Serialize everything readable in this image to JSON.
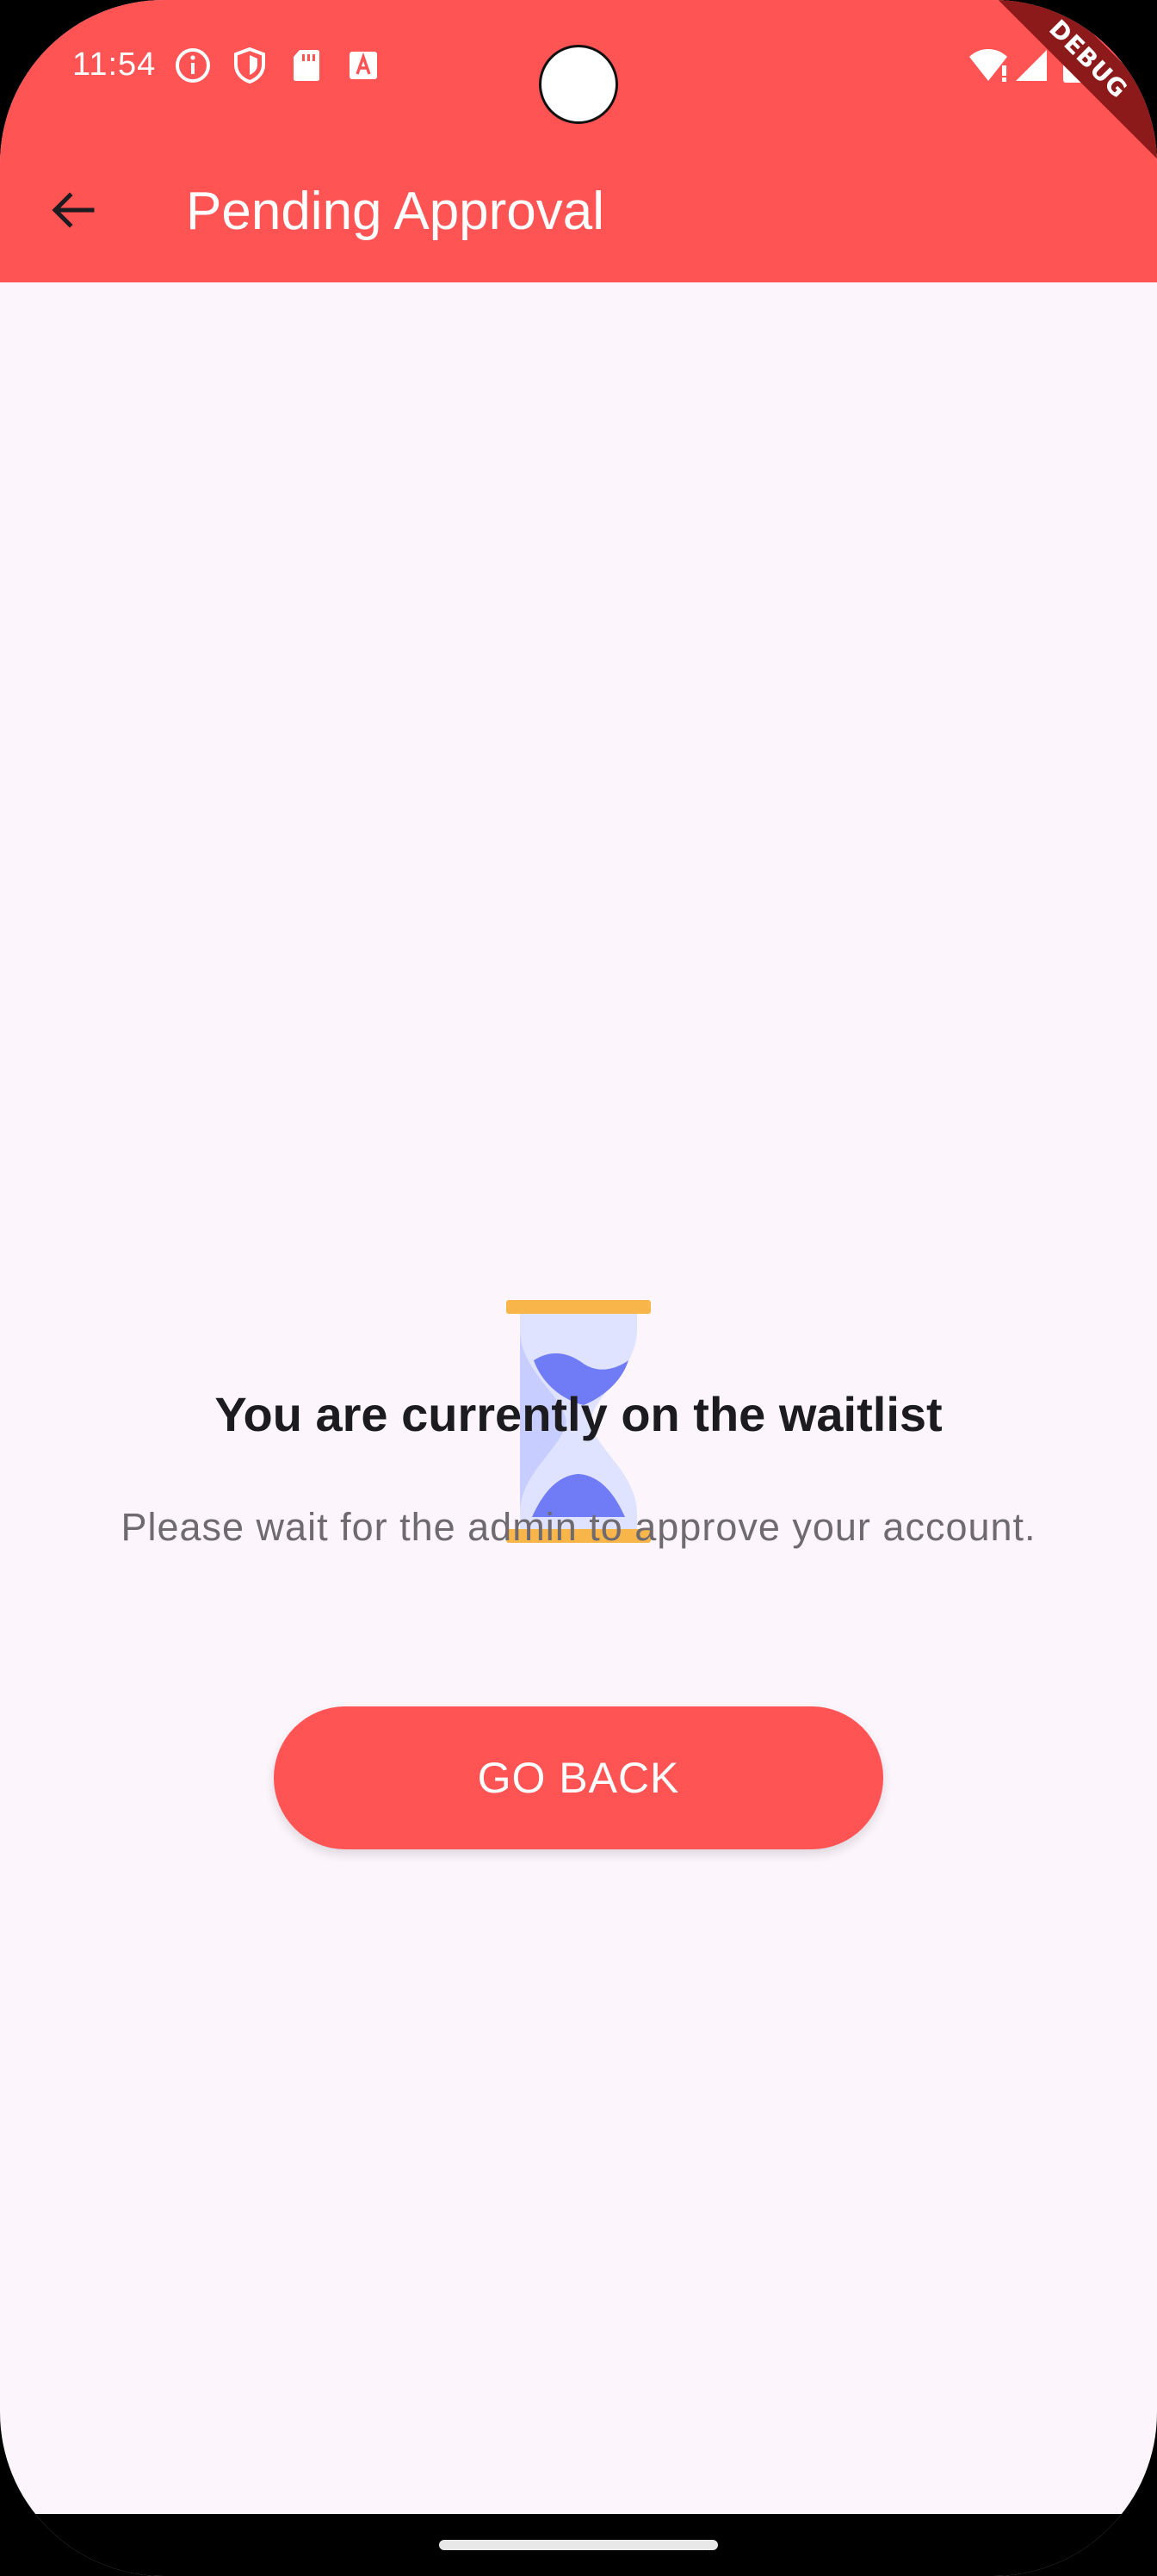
{
  "status_bar": {
    "time": "11:54",
    "left_icons": [
      "info-icon",
      "shield-icon",
      "sd-card-icon",
      "font-a-icon"
    ],
    "right_icons": [
      "wifi-alert-icon",
      "signal-icon",
      "battery-icon"
    ],
    "debug_label": "DEBUG"
  },
  "app_bar": {
    "title": "Pending Approval",
    "back_icon": "arrow-back-icon",
    "background": "#ff5354"
  },
  "main": {
    "illustration": "hourglass-icon",
    "headline": "You are currently on the waitlist",
    "subtext": "Please wait for the admin to approve your account.",
    "button_label": "GO BACK"
  },
  "colors": {
    "accent": "#ff5354",
    "background": "#fcf5fc",
    "hourglass_frame": "#f7b54a",
    "hourglass_glass": "#dfe3ff",
    "hourglass_sand": "#6f7cf5"
  }
}
